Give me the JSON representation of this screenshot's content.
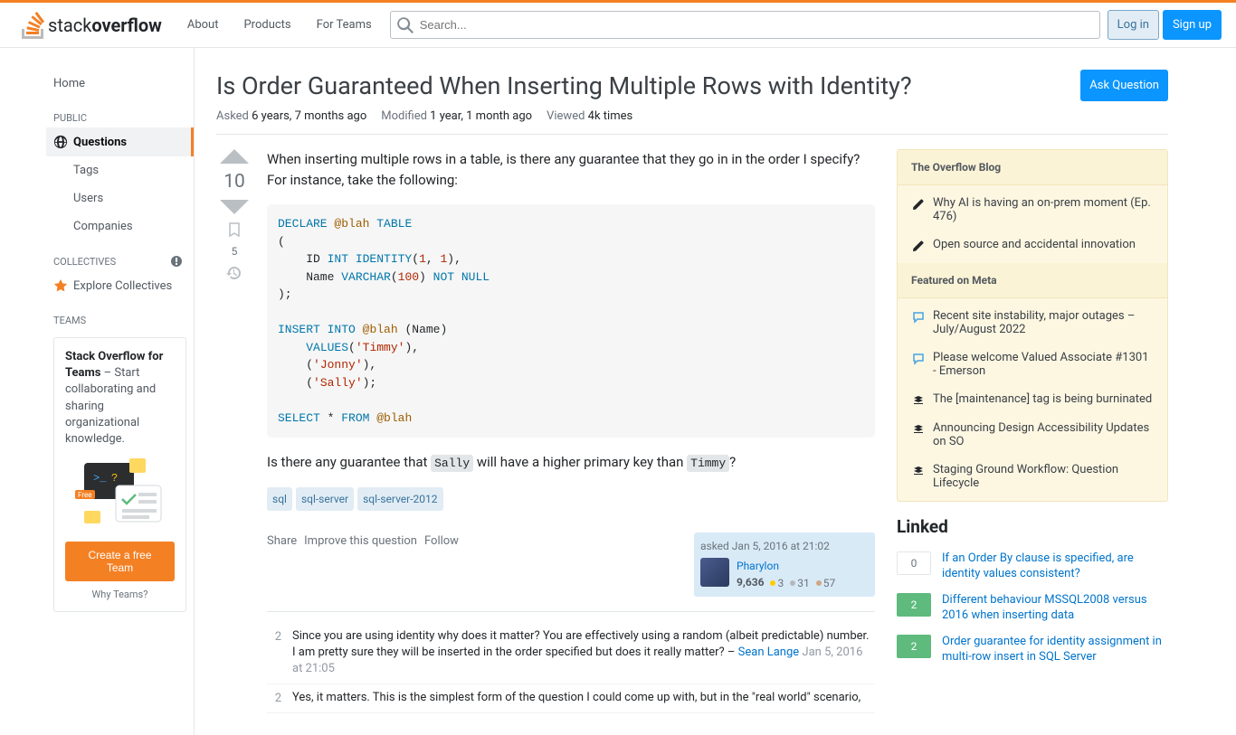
{
  "topnav": {
    "about": "About",
    "products": "Products",
    "teams": "For Teams",
    "search_placeholder": "Search...",
    "login": "Log in",
    "signup": "Sign up"
  },
  "leftnav": {
    "home": "Home",
    "public_heading": "PUBLIC",
    "questions": "Questions",
    "tags": "Tags",
    "users": "Users",
    "companies": "Companies",
    "collectives_heading": "COLLECTIVES",
    "explore": "Explore Collectives",
    "teams_heading": "TEAMS",
    "teams_promo_strong": "Stack Overflow for Teams",
    "teams_promo_text": " – Start collaborating and sharing organizational knowledge.",
    "create_team": "Create a free Team",
    "why_teams": "Why Teams?"
  },
  "question": {
    "title": "Is Order Guaranteed When Inserting Multiple Rows with Identity?",
    "ask_button": "Ask Question",
    "asked_label": "Asked",
    "asked_value": "6 years, 7 months ago",
    "modified_label": "Modified",
    "modified_value": "1 year, 1 month ago",
    "viewed_label": "Viewed",
    "viewed_value": "4k times",
    "votes": "10",
    "bookmarks": "5",
    "body_p1": "When inserting multiple rows in a table, is there any guarantee that they go in in the order I specify? For instance, take the following:",
    "body_p2_pre": "Is there any guarantee that ",
    "body_p2_code1": "Sally",
    "body_p2_mid": " will have a higher primary key than ",
    "body_p2_code2": "Timmy",
    "body_p2_end": "?",
    "tags": [
      "sql",
      "sql-server",
      "sql-server-2012"
    ],
    "actions": {
      "share": "Share",
      "improve": "Improve this question",
      "follow": "Follow"
    },
    "user": {
      "asked_at": "asked Jan 5, 2016 at 21:02",
      "name": "Pharylon",
      "rep": "9,636",
      "gold": "3",
      "silver": "31",
      "bronze": "57"
    }
  },
  "comments": [
    {
      "score": "2",
      "text": "Since you are using identity why does it matter? You are effectively using a random (albeit predictable) number. I am pretty sure they will be inserted in the order specified but does it really matter? – ",
      "author": "Sean Lange",
      "date": "Jan 5, 2016 at 21:05"
    },
    {
      "score": "2",
      "text": "Yes, it matters. This is the simplest form of the question I could come up with, but in the \"real world\" scenario,",
      "author": "",
      "date": ""
    }
  ],
  "sidebar": {
    "blog_heading": "The Overflow Blog",
    "blog_items": [
      "Why AI is having an on-prem moment (Ep. 476)",
      "Open source and accidental innovation"
    ],
    "meta_heading": "Featured on Meta",
    "meta_items": [
      "Recent site instability, major outages – July/August 2022",
      "Please welcome Valued Associate #1301 - Emerson",
      "The [maintenance] tag is being burninated",
      "Announcing Design Accessibility Updates on SO",
      "Staging Ground Workflow: Question Lifecycle"
    ],
    "linked_heading": "Linked",
    "linked": [
      {
        "score": "0",
        "cls": "default",
        "title": "If an Order By clause is specified, are identity values consistent?"
      },
      {
        "score": "2",
        "cls": "answered",
        "title": "Different behaviour MSSQL2008 versus 2016 when inserting data"
      },
      {
        "score": "2",
        "cls": "answered",
        "title": "Order guarantee for identity assignment in multi-row insert in SQL Server"
      }
    ]
  }
}
